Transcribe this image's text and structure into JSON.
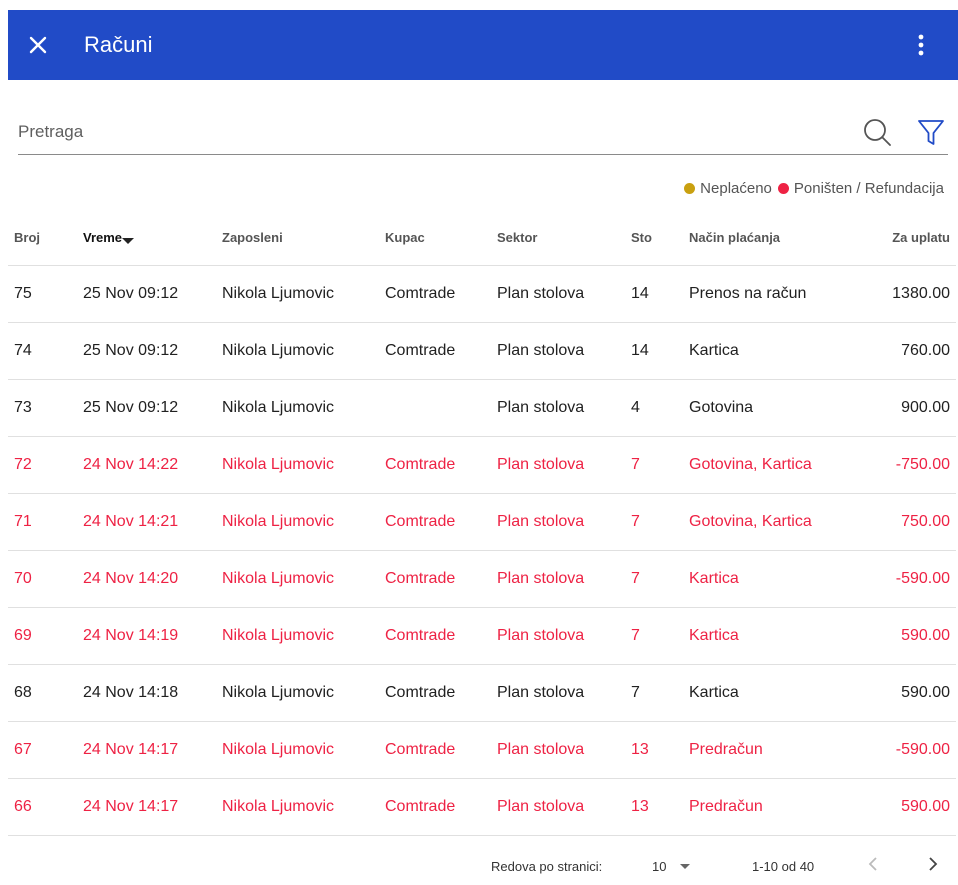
{
  "appbar": {
    "title": "Računi",
    "close_icon": "close-icon",
    "menu_icon": "more-vert-icon",
    "bg_color": "#214bc7"
  },
  "search": {
    "placeholder": "Pretraga",
    "value": "",
    "search_icon": "search-icon",
    "filter_icon": "filter-icon"
  },
  "legend": {
    "unpaid_label": "Neplaćeno",
    "unpaid_color": "#c9a010",
    "cancelled_label": "Poništen / Refundacija",
    "cancelled_color": "#ee2244"
  },
  "table": {
    "columns": [
      "Broj",
      "Vreme",
      "Zaposleni",
      "Kupac",
      "Sektor",
      "Sto",
      "Način plaćanja",
      "Za uplatu"
    ],
    "sorted_column": "Vreme",
    "sort_direction": "desc",
    "rows": [
      {
        "broj": "75",
        "vreme": "25 Nov 09:12",
        "zaposleni": "Nikola Ljumovic",
        "kupac": "Comtrade",
        "sektor": "Plan stolova",
        "sto": "14",
        "nacin": "Prenos na račun",
        "iznos": "1380.00",
        "status": "normal"
      },
      {
        "broj": "74",
        "vreme": "25 Nov 09:12",
        "zaposleni": "Nikola Ljumovic",
        "kupac": "Comtrade",
        "sektor": "Plan stolova",
        "sto": "14",
        "nacin": "Kartica",
        "iznos": "760.00",
        "status": "normal"
      },
      {
        "broj": "73",
        "vreme": "25 Nov 09:12",
        "zaposleni": "Nikola Ljumovic",
        "kupac": "",
        "sektor": "Plan stolova",
        "sto": "4",
        "nacin": "Gotovina",
        "iznos": "900.00",
        "status": "normal"
      },
      {
        "broj": "72",
        "vreme": "24 Nov 14:22",
        "zaposleni": "Nikola Ljumovic",
        "kupac": "Comtrade",
        "sektor": "Plan stolova",
        "sto": "7",
        "nacin": "Gotovina, Kartica",
        "iznos": "-750.00",
        "status": "cancelled"
      },
      {
        "broj": "71",
        "vreme": "24 Nov 14:21",
        "zaposleni": "Nikola Ljumovic",
        "kupac": "Comtrade",
        "sektor": "Plan stolova",
        "sto": "7",
        "nacin": "Gotovina, Kartica",
        "iznos": "750.00",
        "status": "cancelled"
      },
      {
        "broj": "70",
        "vreme": "24 Nov 14:20",
        "zaposleni": "Nikola Ljumovic",
        "kupac": "Comtrade",
        "sektor": "Plan stolova",
        "sto": "7",
        "nacin": "Kartica",
        "iznos": "-590.00",
        "status": "cancelled"
      },
      {
        "broj": "69",
        "vreme": "24 Nov 14:19",
        "zaposleni": "Nikola Ljumovic",
        "kupac": "Comtrade",
        "sektor": "Plan stolova",
        "sto": "7",
        "nacin": "Kartica",
        "iznos": "590.00",
        "status": "cancelled"
      },
      {
        "broj": "68",
        "vreme": "24 Nov 14:18",
        "zaposleni": "Nikola Ljumovic",
        "kupac": "Comtrade",
        "sektor": "Plan stolova",
        "sto": "7",
        "nacin": "Kartica",
        "iznos": "590.00",
        "status": "normal"
      },
      {
        "broj": "67",
        "vreme": "24 Nov 14:17",
        "zaposleni": "Nikola Ljumovic",
        "kupac": "Comtrade",
        "sektor": "Plan stolova",
        "sto": "13",
        "nacin": "Predračun",
        "iznos": "-590.00",
        "status": "cancelled"
      },
      {
        "broj": "66",
        "vreme": "24 Nov 14:17",
        "zaposleni": "Nikola Ljumovic",
        "kupac": "Comtrade",
        "sektor": "Plan stolova",
        "sto": "13",
        "nacin": "Predračun",
        "iznos": "590.00",
        "status": "cancelled"
      }
    ]
  },
  "pagination": {
    "rows_per_page_label": "Redova po stranici:",
    "rows_per_page": "10",
    "range_text": "1-10 od 40",
    "prev_icon": "chevron-left-icon",
    "next_icon": "chevron-right-icon"
  }
}
